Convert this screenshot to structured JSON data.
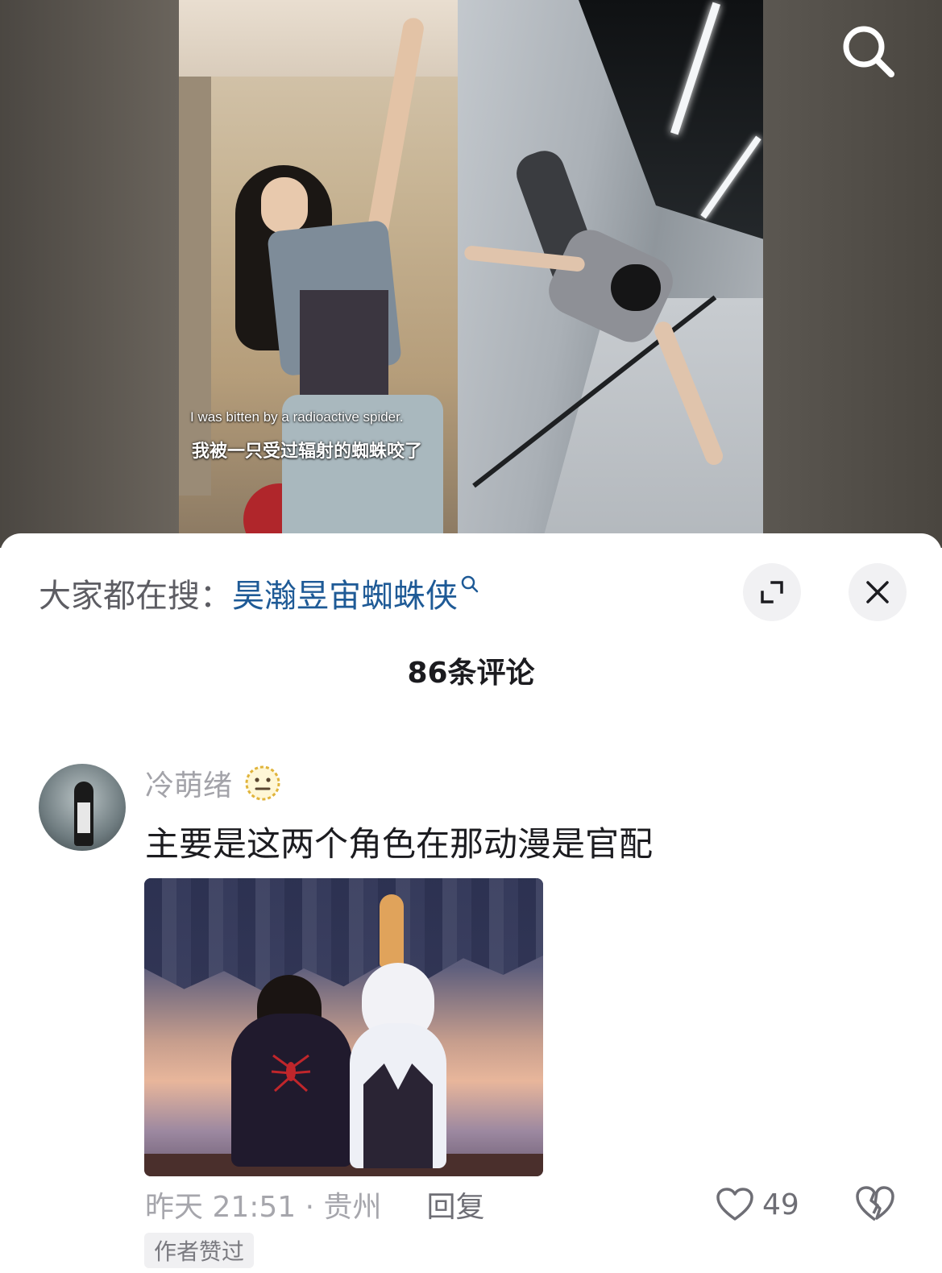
{
  "video": {
    "caption_en": "I was bitten by a radioactive spider.",
    "caption_zh": "我被一只受过辐射的蜘蛛咬了",
    "search_icon": "search-icon"
  },
  "sheet": {
    "trending_label": "大家都在搜：",
    "trending_query": "昊瀚昱宙蜘蛛侠",
    "expand_icon": "expand-icon",
    "close_icon": "close-icon",
    "comment_count": "86条评论"
  },
  "comments": [
    {
      "username": "冷萌绪",
      "badge_icon": "neutral-face-emoji-icon",
      "text": "主要是这两个角色在那动漫是官配",
      "time_location": "昨天 21:51 · 贵州",
      "reply_label": "回复",
      "likes": "49",
      "like_icon": "heart-icon",
      "dislike_icon": "broken-heart-icon",
      "author_liked": "作者赞过"
    }
  ],
  "colors": {
    "link_blue": "#1e5a96",
    "muted_gray": "#a6a6ac",
    "text_dark": "#1c1c20"
  }
}
